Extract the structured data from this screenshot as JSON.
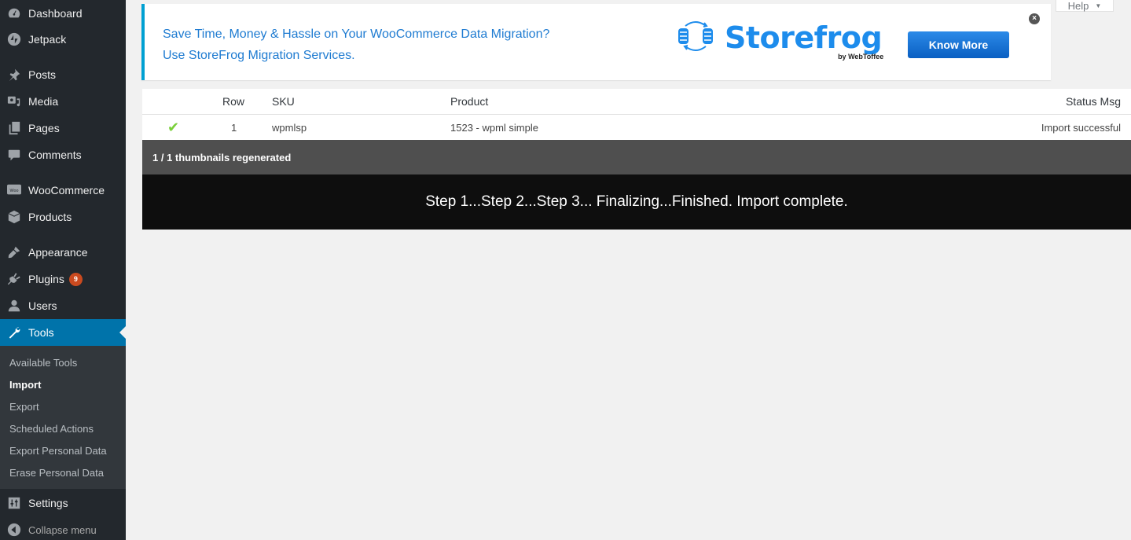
{
  "sidebar": {
    "items": [
      {
        "id": "dashboard",
        "label": "Dashboard",
        "icon": "dashboard-icon"
      },
      {
        "id": "jetpack",
        "label": "Jetpack",
        "icon": "jetpack-icon"
      },
      {
        "id": "posts",
        "label": "Posts",
        "icon": "pin-icon"
      },
      {
        "id": "media",
        "label": "Media",
        "icon": "media-icon"
      },
      {
        "id": "pages",
        "label": "Pages",
        "icon": "pages-icon"
      },
      {
        "id": "comments",
        "label": "Comments",
        "icon": "comment-icon"
      },
      {
        "id": "woocommerce",
        "label": "WooCommerce",
        "icon": "woo-icon"
      },
      {
        "id": "products",
        "label": "Products",
        "icon": "box-icon"
      },
      {
        "id": "appearance",
        "label": "Appearance",
        "icon": "brush-icon"
      },
      {
        "id": "plugins",
        "label": "Plugins",
        "icon": "plug-icon",
        "badge": "9"
      },
      {
        "id": "users",
        "label": "Users",
        "icon": "user-icon"
      },
      {
        "id": "tools",
        "label": "Tools",
        "icon": "wrench-icon",
        "active": true
      },
      {
        "id": "settings",
        "label": "Settings",
        "icon": "sliders-icon"
      },
      {
        "id": "collapse",
        "label": "Collapse menu",
        "icon": "collapse-icon"
      }
    ],
    "submenu": [
      {
        "label": "Available Tools"
      },
      {
        "label": "Import",
        "current": true
      },
      {
        "label": "Export"
      },
      {
        "label": "Scheduled Actions"
      },
      {
        "label": "Export Personal Data"
      },
      {
        "label": "Erase Personal Data"
      }
    ]
  },
  "help_tab": {
    "label": "Help",
    "arrow": "▼"
  },
  "ad": {
    "line1": "Save Time, Money & Hassle on Your WooCommerce Data Migration?",
    "line2": "Use StoreFrog Migration Services.",
    "brand": "Storefrog",
    "brand_by": "by WebToffee",
    "cta": "Know More",
    "close": "×",
    "accent": "#1d8cec"
  },
  "results": {
    "columns": {
      "row": "Row",
      "sku": "SKU",
      "product": "Product",
      "status_msg": "Status Msg"
    },
    "rows": [
      {
        "status_icon": "✔",
        "row": "1",
        "sku": "wpmlsp",
        "product": "1523 - wpml simple",
        "status_msg": "Import successful"
      }
    ]
  },
  "thumbnails_msg": "1 / 1 thumbnails regenerated",
  "import_msg": "Step 1...Step 2...Step 3... Finalizing...Finished. Import complete."
}
